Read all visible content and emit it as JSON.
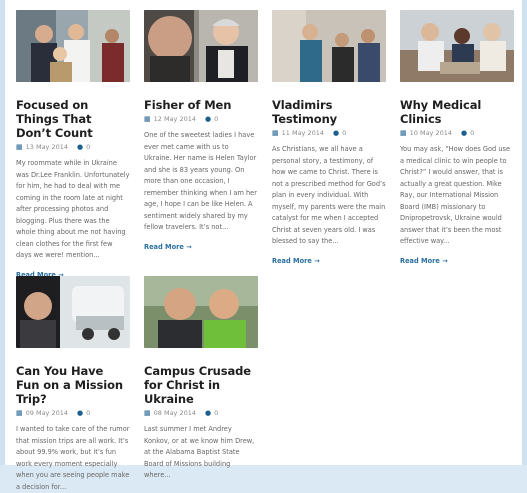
{
  "posts": [
    {
      "title": "Focused on Things That Don’t Count",
      "date": "13 May 2014",
      "comments": "0",
      "excerpt": "My roommate while in Ukraine was Dr.Lee Franklin. Unfortunately for him, he had to deal with me coming in the room late at night after processing photos and blogging. Plus there was the whole thing about me not having clean clothes for the first few days we were! mention...",
      "readmore": "Read More →"
    },
    {
      "title": "Fisher of Men",
      "date": "12 May 2014",
      "comments": "0",
      "excerpt": "One of the sweetest ladies I have ever met came with us to Ukraine. Her name is Helen Taylor and she is 83 years young. On more than one occasion, I remember thinking when I am her age, I hope I can be like Helen. A sentiment widely shared by my fellow travelers. It’s not...",
      "readmore": "Read More →"
    },
    {
      "title": "Vladimirs Testimony",
      "date": "11 May 2014",
      "comments": "0",
      "excerpt": "As Christians, we all have a personal story, a testimony, of how we came to Christ. There is not a prescribed method for God’s plan in every individual. With myself, my parents were the main catalyst for me when I accepted Christ at seven years old. I was blessed to say the...",
      "readmore": "Read More →"
    },
    {
      "title": "Why Medical Clinics",
      "date": "10 May 2014",
      "comments": "0",
      "excerpt": "You may ask, “How does God use a medical clinic to win people to Christ?” I would answer, that is actually a great question. Mike Ray, our International Mission Board (IMB) missionary to Dnipropetrovsk, Ukraine would answer that it’s been the most effective way...",
      "readmore": "Read More →"
    },
    {
      "title": "Can You Have Fun on a Mission Trip?",
      "date": "09 May 2014",
      "comments": "0",
      "excerpt": "I wanted to take care of the rumor that mission trips are all work. It’s about 99.9% work, but it’s fun work every moment especially when you are seeing people make a decision for...",
      "readmore": ""
    },
    {
      "title": "Campus Crusade for Christ in Ukraine",
      "date": "08 May 2014",
      "comments": "0",
      "excerpt": "Last summer I met Andrey Konkov, or at we know him Drew, at the Alabama Baptist State Board of Missions building where...",
      "readmore": ""
    }
  ],
  "icons": {
    "calendar": "calendar-icon",
    "comment": "comment-icon"
  },
  "colors": {
    "accent": "#2a6fa1",
    "title": "#1f1f1f",
    "meta_icon": "#1b5f8e"
  }
}
